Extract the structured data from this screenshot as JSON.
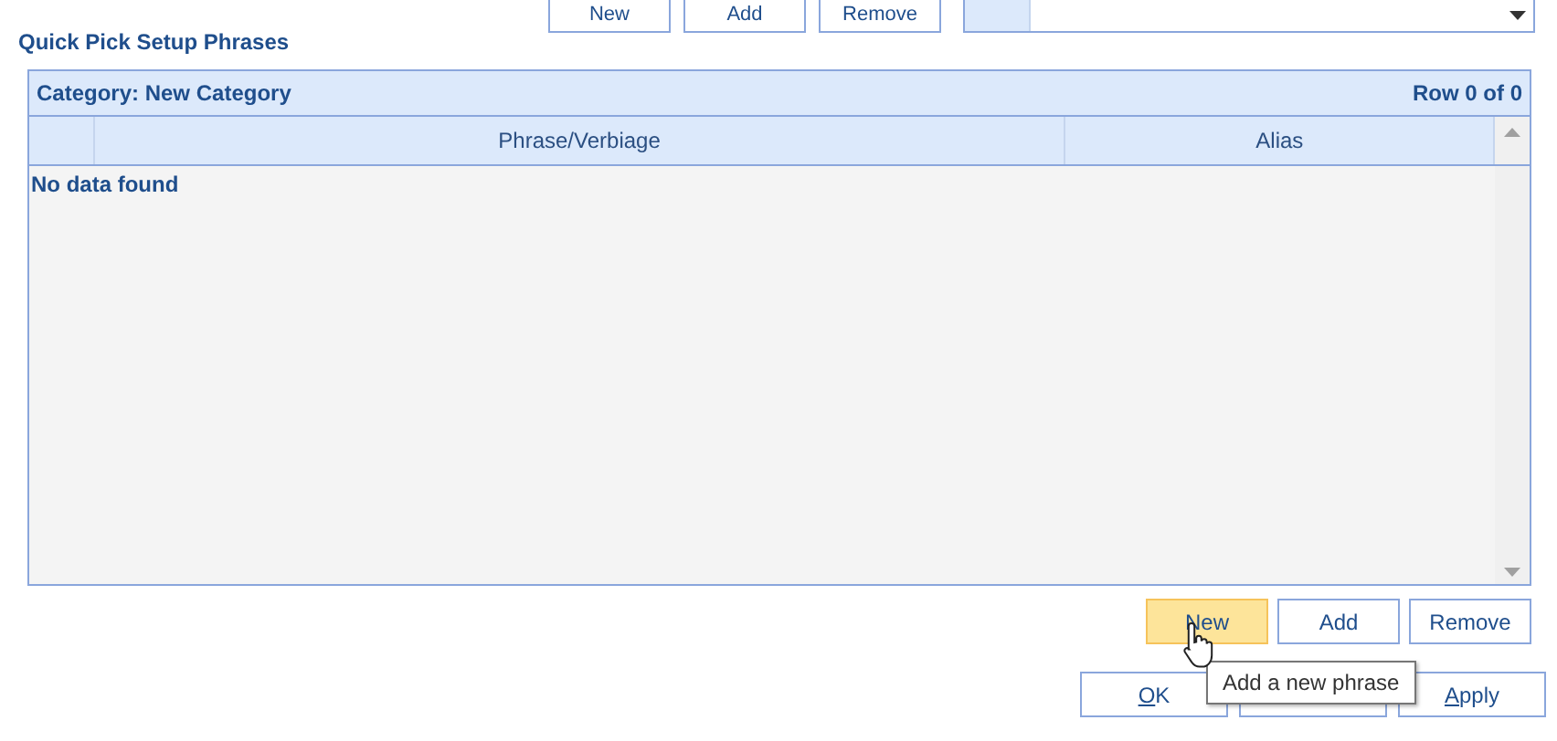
{
  "top_buttons": [
    {
      "label": "New"
    },
    {
      "label": "Add"
    },
    {
      "label": "Remove"
    }
  ],
  "title": "Quick Pick Setup Phrases",
  "grid": {
    "category": "Category: New Category",
    "row_count": "Row 0 of 0",
    "columns": [
      "Phrase/Verbiage",
      "Alias"
    ],
    "empty_text": "No data found"
  },
  "phrase_buttons": [
    {
      "label": "New",
      "hovered": true
    },
    {
      "label": "Add",
      "hovered": false
    },
    {
      "label": "Remove",
      "hovered": false
    }
  ],
  "dialog_buttons": [
    {
      "kind": "text",
      "mnemonic": "O",
      "rest": "K"
    },
    {
      "kind": "covered"
    },
    {
      "kind": "text",
      "mnemonic": "A",
      "rest": "pply"
    }
  ],
  "tooltip": "Add a new phrase"
}
